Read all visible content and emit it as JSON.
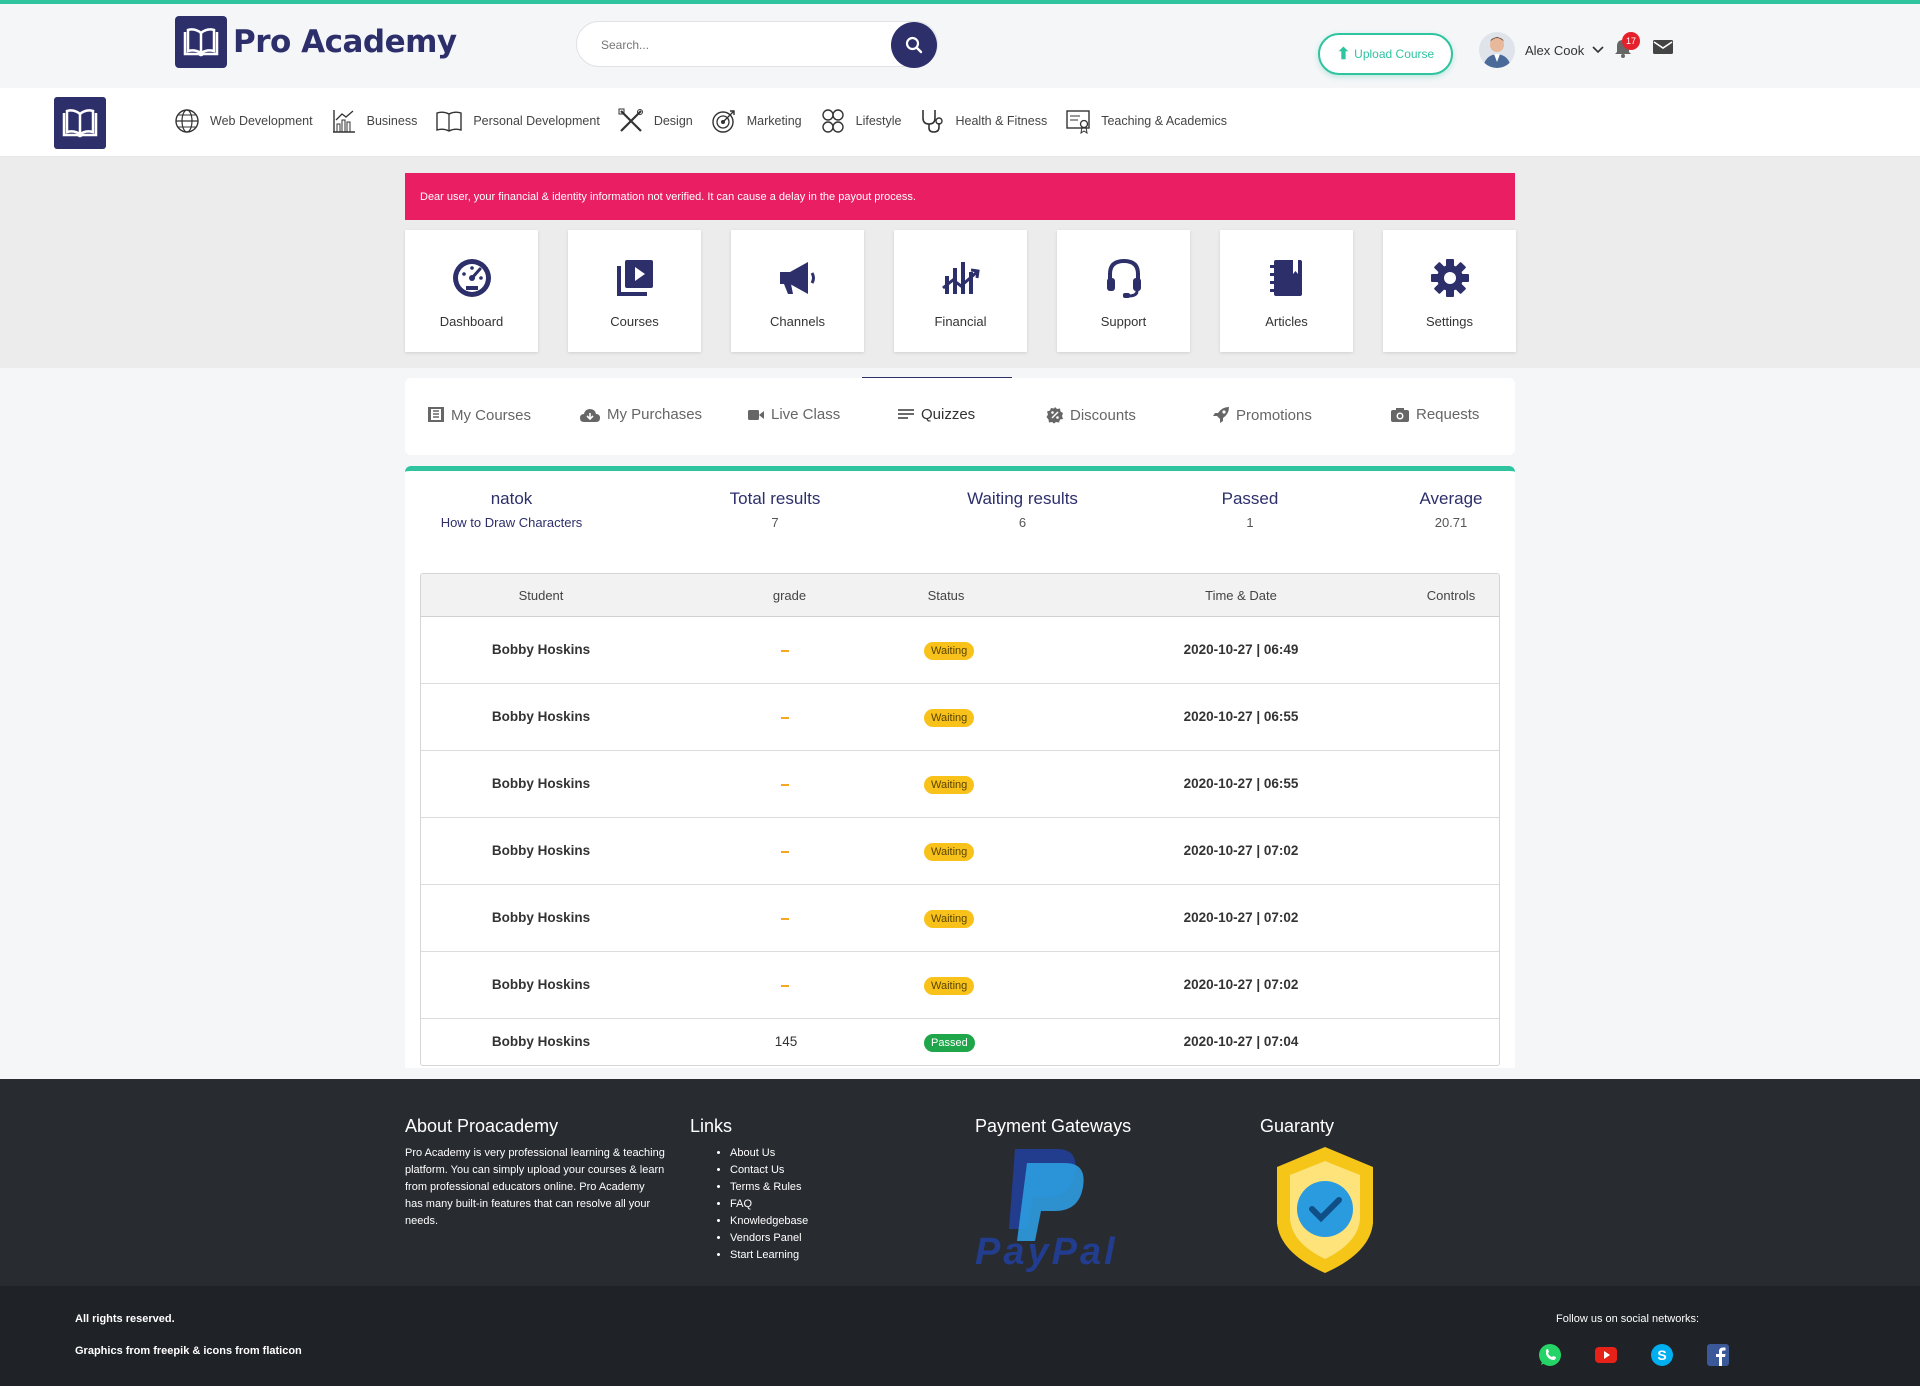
{
  "header": {
    "logo_text": "Pro Academy",
    "search_placeholder": "Search...",
    "upload_label": "Upload Course",
    "user_name": "Alex Cook",
    "notification_count": "17"
  },
  "categories": [
    {
      "label": "Web Development",
      "icon": "globe-icon"
    },
    {
      "label": "Business",
      "icon": "chart-icon"
    },
    {
      "label": "Personal Development",
      "icon": "book-icon"
    },
    {
      "label": "Design",
      "icon": "design-tools-icon"
    },
    {
      "label": "Marketing",
      "icon": "target-icon"
    },
    {
      "label": "Lifestyle",
      "icon": "lifestyle-icon"
    },
    {
      "label": "Health & Fitness",
      "icon": "stethoscope-icon"
    },
    {
      "label": "Teaching & Academics",
      "icon": "certificate-icon"
    }
  ],
  "alert": "Dear user, your financial & identity information not verified. It can cause a delay in the payout process.",
  "tiles": [
    {
      "label": "Dashboard",
      "icon": "speedometer-icon"
    },
    {
      "label": "Courses",
      "icon": "video-library-icon"
    },
    {
      "label": "Channels",
      "icon": "megaphone-icon"
    },
    {
      "label": "Financial",
      "icon": "growth-chart-icon"
    },
    {
      "label": "Support",
      "icon": "headset-icon"
    },
    {
      "label": "Articles",
      "icon": "notebook-icon"
    },
    {
      "label": "Settings",
      "icon": "gear-icon"
    }
  ],
  "subtabs": [
    {
      "label": "My Courses",
      "icon": "courses-icon"
    },
    {
      "label": "My Purchases",
      "icon": "cloud-download-icon"
    },
    {
      "label": "Live Class",
      "icon": "video-camera-icon"
    },
    {
      "label": "Quizzes",
      "icon": "list-icon",
      "active": true
    },
    {
      "label": "Discounts",
      "icon": "discount-icon"
    },
    {
      "label": "Promotions",
      "icon": "rocket-icon"
    },
    {
      "label": "Requests",
      "icon": "camera-icon"
    }
  ],
  "quiz": {
    "name": "natok",
    "course": "How to Draw Characters",
    "total_label": "Total results",
    "total_value": "7",
    "waiting_label": "Waiting results",
    "waiting_value": "6",
    "passed_label": "Passed",
    "passed_value": "1",
    "average_label": "Average",
    "average_value": "20.71"
  },
  "table": {
    "headers": {
      "student": "Student",
      "grade": "grade",
      "status": "Status",
      "datetime": "Time & Date",
      "controls": "Controls"
    },
    "rows": [
      {
        "student": "Bobby Hoskins",
        "grade": "",
        "status": "Waiting",
        "datetime": "2020-10-27 | 06:49"
      },
      {
        "student": "Bobby Hoskins",
        "grade": "",
        "status": "Waiting",
        "datetime": "2020-10-27 | 06:55"
      },
      {
        "student": "Bobby Hoskins",
        "grade": "",
        "status": "Waiting",
        "datetime": "2020-10-27 | 06:55"
      },
      {
        "student": "Bobby Hoskins",
        "grade": "",
        "status": "Waiting",
        "datetime": "2020-10-27 | 07:02"
      },
      {
        "student": "Bobby Hoskins",
        "grade": "",
        "status": "Waiting",
        "datetime": "2020-10-27 | 07:02"
      },
      {
        "student": "Bobby Hoskins",
        "grade": "",
        "status": "Waiting",
        "datetime": "2020-10-27 | 07:02"
      },
      {
        "student": "Bobby Hoskins",
        "grade": "145",
        "status": "Passed",
        "datetime": "2020-10-27 | 07:04"
      }
    ]
  },
  "footer": {
    "about_title": "About Proacademy",
    "about_text": "Pro Academy is very professional learning & teaching platform. You can simply upload your courses & learn from professional educators online. Pro Academy has many built-in features that can resolve all your needs.",
    "links_title": "Links",
    "links": [
      "About Us",
      "Contact Us",
      "Terms & Rules",
      "FAQ",
      "Knowledgebase",
      "Vendors Panel",
      "Start Learning"
    ],
    "payment_title": "Payment Gateways",
    "paypal_text": "PayPal",
    "guaranty_title": "Guaranty",
    "rights": "All rights reserved.",
    "credits": "Graphics from freepik & icons from flaticon",
    "follow": "Follow us on social networks:"
  },
  "colors": {
    "brand": "#2d2f6b",
    "accent": "#2ec4a0",
    "alert": "#e91e63",
    "waiting": "#f8c21a",
    "passed": "#1fa64b"
  }
}
